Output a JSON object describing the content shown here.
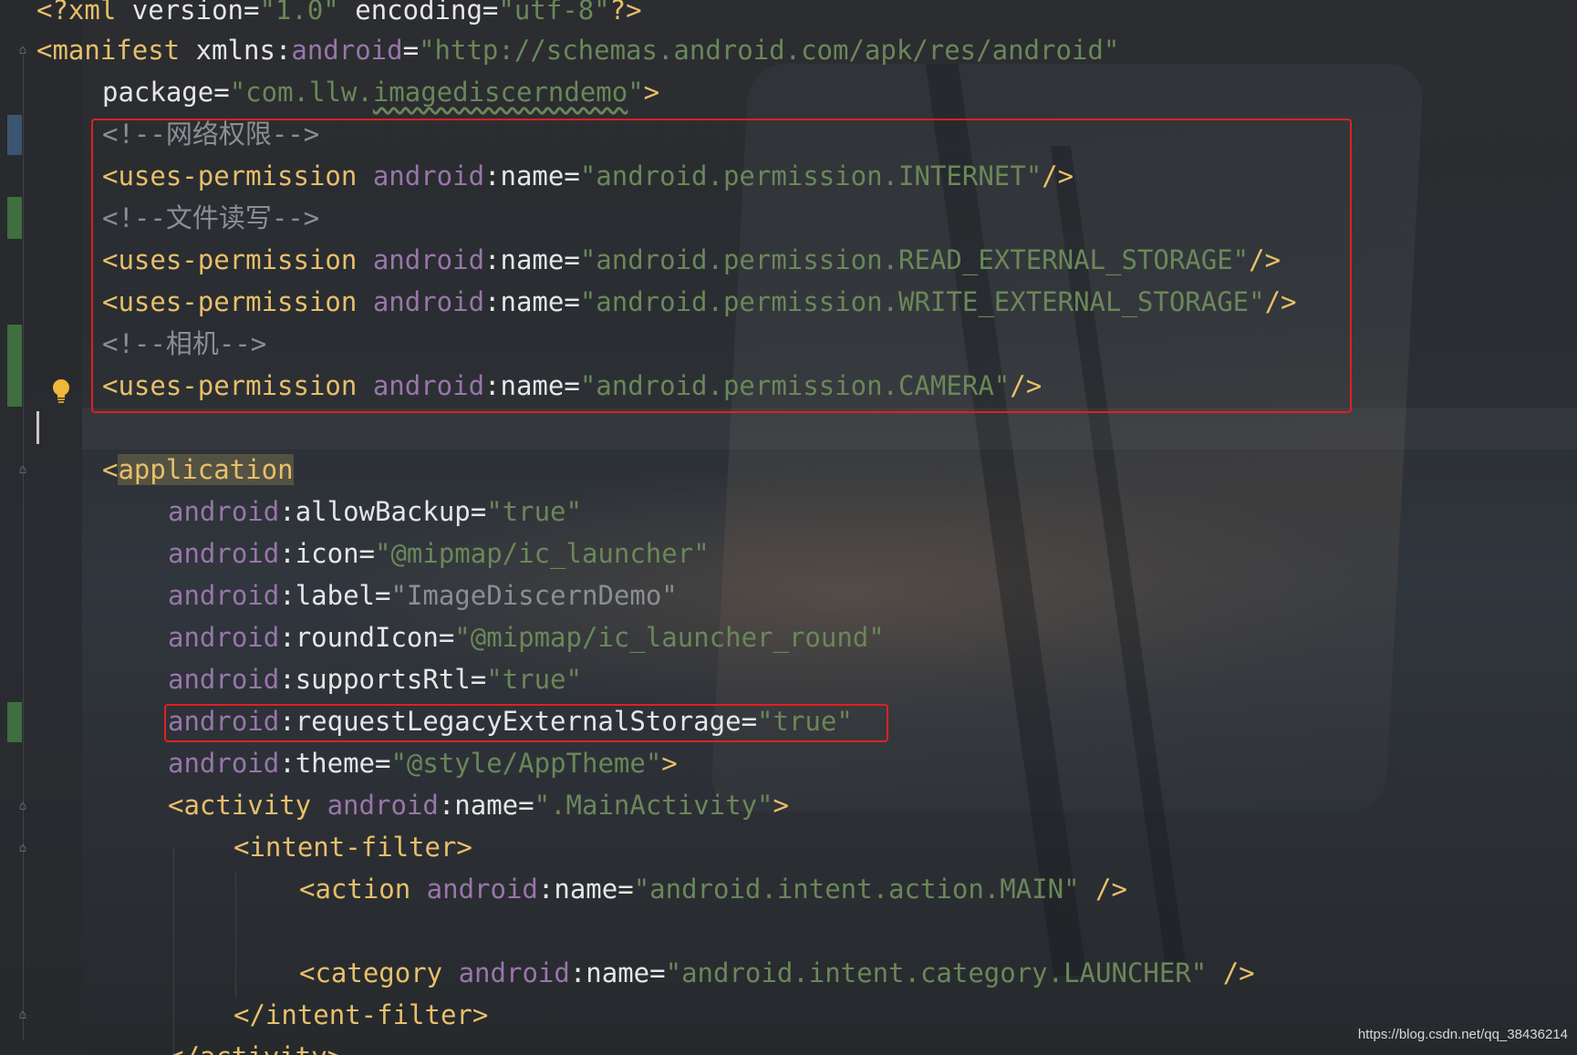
{
  "editor": {
    "file_type": "AndroidManifest.xml",
    "colors": {
      "background": "#2b2d30",
      "tag": "#e8bf6a",
      "namespace": "#9876aa",
      "value": "#6a8759",
      "comment": "#8a8f94",
      "highlight_box": "#e02020"
    }
  },
  "code": {
    "l1": {
      "pi_open": "<?xml",
      "attr1": " version",
      "eq1": "=",
      "val1": "\"1.0\"",
      "attr2": " encoding",
      "eq2": "=",
      "val2": "\"utf-8\"",
      "pi_close": "?>"
    },
    "l2": {
      "tag": "<manifest",
      "attr": " xmlns",
      "colon": ":",
      "ns": "android",
      "eq": "=",
      "val": "\"http://schemas.android.com/apk/res/android\""
    },
    "l3": {
      "attr": "package",
      "eq": "=",
      "q1": "\"",
      "val_pre": "com.llw.",
      "val_squiggle": "imagediscerndemo",
      "q2": "\"",
      "close": ">"
    },
    "l4": {
      "comment": "<!--网络权限-->"
    },
    "l5": {
      "tag": "<uses-permission",
      "ns": " android",
      "colon": ":",
      "attr": "name",
      "eq": "=",
      "val": "\"android.permission.INTERNET\"",
      "close": "/>"
    },
    "l6": {
      "comment": "<!--文件读写-->"
    },
    "l7": {
      "tag": "<uses-permission",
      "ns": " android",
      "colon": ":",
      "attr": "name",
      "eq": "=",
      "val": "\"android.permission.READ_EXTERNAL_STORAGE\"",
      "close": "/>"
    },
    "l8": {
      "tag": "<uses-permission",
      "ns": " android",
      "colon": ":",
      "attr": "name",
      "eq": "=",
      "val": "\"android.permission.WRITE_EXTERNAL_STORAGE\"",
      "close": "/>"
    },
    "l9": {
      "comment": "<!--相机-->"
    },
    "l10": {
      "tag": "<uses-permission",
      "ns": " android",
      "colon": ":",
      "attr": "name",
      "eq": "=",
      "val": "\"android.permission.CAMERA\"",
      "close": "/>"
    },
    "l12": {
      "lt": "<",
      "tag": "application"
    },
    "l13": {
      "ns": "android",
      "colon": ":",
      "attr": "allowBackup",
      "eq": "=",
      "val": "\"true\""
    },
    "l14": {
      "ns": "android",
      "colon": ":",
      "attr": "icon",
      "eq": "=",
      "val": "\"@mipmap/ic_launcher\""
    },
    "l15": {
      "ns": "android",
      "colon": ":",
      "attr": "label",
      "eq": "=",
      "val": "\"ImageDiscernDemo\""
    },
    "l16": {
      "ns": "android",
      "colon": ":",
      "attr": "roundIcon",
      "eq": "=",
      "val": "\"@mipmap/ic_launcher_round\""
    },
    "l17": {
      "ns": "android",
      "colon": ":",
      "attr": "supportsRtl",
      "eq": "=",
      "val": "\"true\""
    },
    "l18": {
      "ns": "android",
      "colon": ":",
      "attr": "requestLegacyExternalStorage",
      "eq": "=",
      "val": "\"true\""
    },
    "l19": {
      "ns": "android",
      "colon": ":",
      "attr": "theme",
      "eq": "=",
      "val": "\"@style/AppTheme\"",
      "close": ">"
    },
    "l20": {
      "tag": "<activity",
      "ns": " android",
      "colon": ":",
      "attr": "name",
      "eq": "=",
      "val": "\".MainActivity\"",
      "close": ">"
    },
    "l21": {
      "tag": "<intent-filter>"
    },
    "l22": {
      "tag": "<action",
      "ns": " android",
      "colon": ":",
      "attr": "name",
      "eq": "=",
      "val": "\"android.intent.action.MAIN\"",
      "close": " />"
    },
    "l24": {
      "tag": "<category",
      "ns": " android",
      "colon": ":",
      "attr": "name",
      "eq": "=",
      "val": "\"android.intent.category.LAUNCHER\"",
      "close": " />"
    },
    "l25": {
      "tag": "</intent-filter>"
    },
    "l26": {
      "tag": "</activity>"
    }
  },
  "watermark": "https://blog.csdn.net/qq_38436214"
}
